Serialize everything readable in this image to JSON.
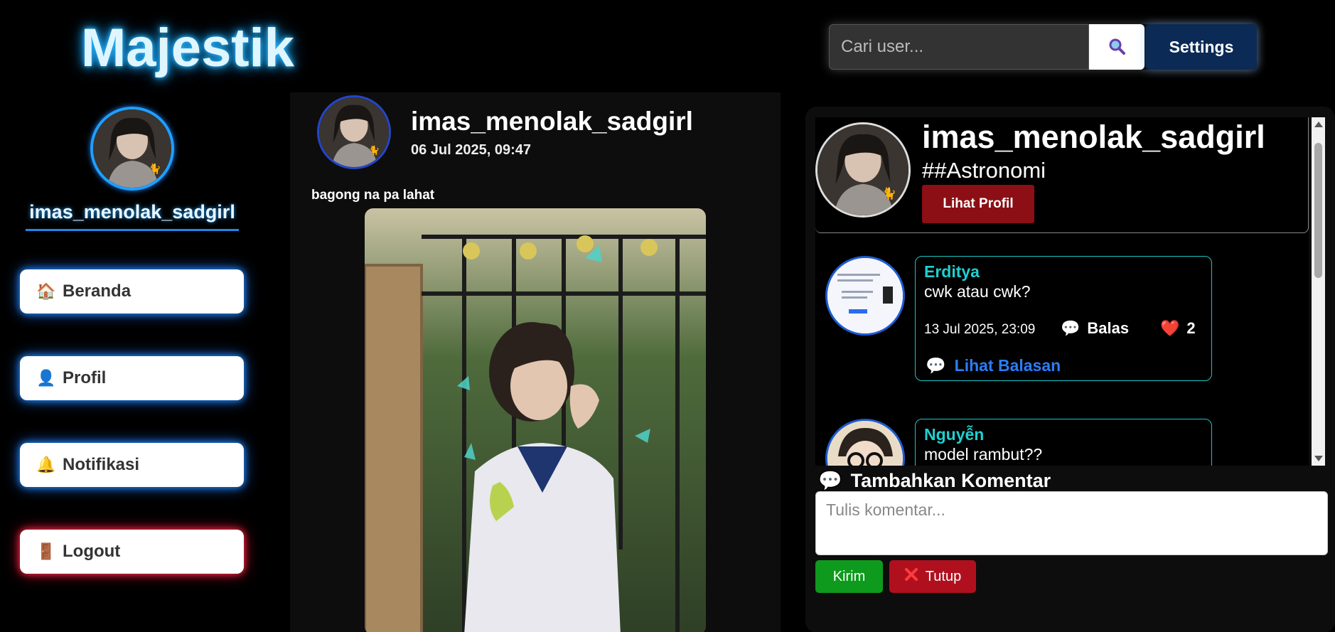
{
  "header": {
    "logo": "Majestik",
    "search_placeholder": "Cari user...",
    "settings_label": "Settings"
  },
  "sidebar": {
    "username": "imas_menolak_sadgirl",
    "nav": [
      {
        "label": "Beranda",
        "icon": "house-icon"
      },
      {
        "label": "Profil",
        "icon": "user-icon"
      },
      {
        "label": "Notifikasi",
        "icon": "bell-icon"
      },
      {
        "label": "Logout",
        "icon": "door-icon"
      }
    ]
  },
  "post": {
    "username": "imas_menolak_sadgirl",
    "date": "06 Jul 2025, 09:47",
    "caption": "bagong na pa lahat"
  },
  "comment_panel": {
    "profile": {
      "username": "imas_menolak_sadgirl",
      "tag": "##Astronomi",
      "view_profile_label": "Lihat Profil"
    },
    "comments": [
      {
        "name": "Erditya",
        "text": "cwk atau cwk?",
        "date": "13 Jul 2025, 23:09",
        "reply_label": "Balas",
        "likes": "2",
        "view_replies_label": "Lihat Balasan"
      },
      {
        "name": "Nguyễn",
        "text": "model rambut??"
      }
    ],
    "add_comment_title": "Tambahkan Komentar",
    "input_placeholder": "Tulis komentar...",
    "send_label": "Kirim",
    "close_label": "Tutup"
  },
  "colors": {
    "accent_blue": "#1ea0ff",
    "comment_name": "#1fd0d0",
    "link_blue": "#2a7df5",
    "danger": "#8b0f14",
    "success": "#0e9a1c"
  }
}
